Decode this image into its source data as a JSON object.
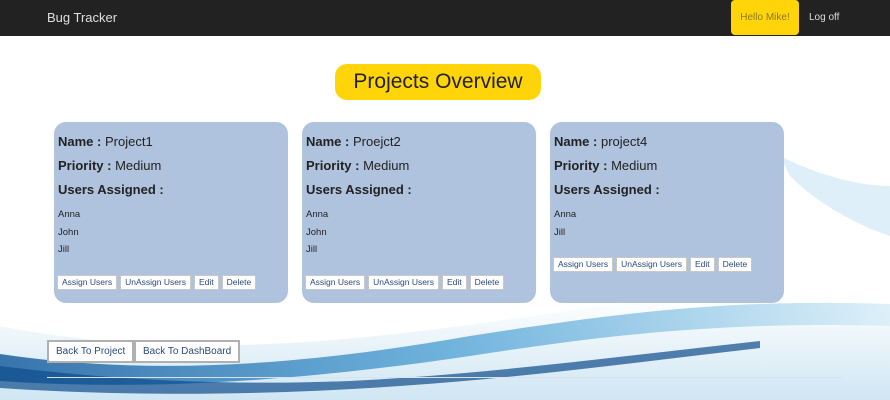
{
  "navbar": {
    "brand": "Bug Tracker",
    "greeting": "Hello Mike!",
    "logoff": "Log off"
  },
  "page_title": "Projects Overview",
  "labels": {
    "name": "Name :",
    "priority": "Priority :",
    "users_assigned": "Users Assigned :"
  },
  "projects": [
    {
      "name": "Project1",
      "priority": "Medium",
      "users": [
        "Anna",
        "John",
        "Jill"
      ]
    },
    {
      "name": "Proejct2",
      "priority": "Medium",
      "users": [
        "Anna",
        "John",
        "Jill"
      ]
    },
    {
      "name": "project4",
      "priority": "Medium",
      "users": [
        "Anna",
        "Jill"
      ]
    }
  ],
  "card_actions": {
    "assign": "Assign Users",
    "unassign": "UnAssign Users",
    "edit": "Edit",
    "delete": "Delete"
  },
  "footer_buttons": {
    "back_project": "Back To Project",
    "back_dashboard": "Back To DashBoard"
  },
  "colors": {
    "navbar": "#222222",
    "accent_yellow": "#ffd50a",
    "card": "#b0c3de"
  }
}
